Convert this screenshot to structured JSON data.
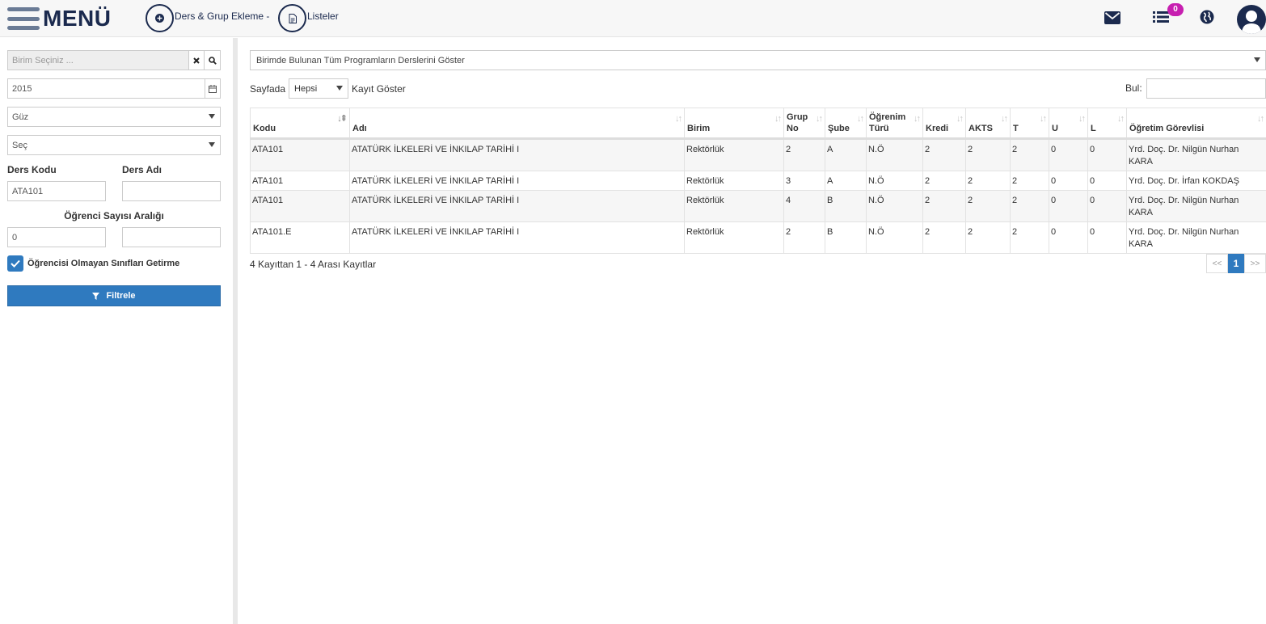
{
  "header": {
    "menu_label": "MENÜ",
    "nav": [
      {
        "label": "Ders & Grup Ekleme -",
        "icon": "plus-circle-icon"
      },
      {
        "label": "Listeler",
        "icon": "document-icon"
      }
    ],
    "notification_count": "0",
    "icons": [
      "envelope-icon",
      "list-icon",
      "globe-icon",
      "user-avatar-icon"
    ]
  },
  "sidebar": {
    "unit_placeholder": "Birim Seçiniz ...",
    "year": "2015",
    "term": "Güz",
    "select_default": "Seç",
    "course_code_label": "Ders Kodu",
    "course_name_label": "Ders Adı",
    "course_code_value": "ATA101",
    "course_name_value": "",
    "student_range_label": "Öğrenci Sayısı Aralığı",
    "student_min": "0",
    "student_max": "",
    "exclude_empty_label": "Öğrencisi Olmayan Sınıfları Getirme",
    "exclude_empty_checked": true,
    "filter_label": "Filtrele"
  },
  "main": {
    "program_select": "Birimde Bulunan Tüm Programların Derslerini Göster",
    "length_prefix": "Sayfada",
    "length_value": "Hepsi",
    "length_suffix": "Kayıt Göster",
    "search_label": "Bul:",
    "search_value": "",
    "columns": {
      "kodu": "Kodu",
      "adi": "Adı",
      "birim": "Birim",
      "grup_no": [
        "Grup",
        "No"
      ],
      "sube": "Şube",
      "ogrenim_turu": [
        "Öğrenim",
        "Türü"
      ],
      "kredi": "Kredi",
      "akts": "AKTS",
      "t": "T",
      "u": "U",
      "l": "L",
      "ogretim_gorevlisi": "Öğretim Görevlisi"
    },
    "rows": [
      {
        "kodu": "ATA101",
        "adi": "ATATÜRK İLKELERİ VE İNKILAP TARİHİ I",
        "birim": "Rektörlük",
        "grup_no": "2",
        "sube": "A",
        "ogrenim_turu": "N.Ö",
        "kredi": "2",
        "akts": "2",
        "t": "2",
        "u": "0",
        "l": "0",
        "ogretim_gorevlisi": "Yrd. Doç. Dr. Nilgün Nurhan KARA"
      },
      {
        "kodu": "ATA101",
        "adi": "ATATÜRK İLKELERİ VE İNKILAP TARİHİ I",
        "birim": "Rektörlük",
        "grup_no": "3",
        "sube": "A",
        "ogrenim_turu": "N.Ö",
        "kredi": "2",
        "akts": "2",
        "t": "2",
        "u": "0",
        "l": "0",
        "ogretim_gorevlisi": "Yrd. Doç. Dr. İrfan KOKDAŞ"
      },
      {
        "kodu": "ATA101",
        "adi": "ATATÜRK İLKELERİ VE İNKILAP TARİHİ I",
        "birim": "Rektörlük",
        "grup_no": "4",
        "sube": "B",
        "ogrenim_turu": "N.Ö",
        "kredi": "2",
        "akts": "2",
        "t": "2",
        "u": "0",
        "l": "0",
        "ogretim_gorevlisi": "Yrd. Doç. Dr. Nilgün Nurhan KARA"
      },
      {
        "kodu": "ATA101.E",
        "adi": "ATATÜRK İLKELERİ VE İNKILAP TARİHİ I",
        "birim": "Rektörlük",
        "grup_no": "2",
        "sube": "B",
        "ogrenim_turu": "N.Ö",
        "kredi": "2",
        "akts": "2",
        "t": "2",
        "u": "0",
        "l": "0",
        "ogretim_gorevlisi": "Yrd. Doç. Dr. Nilgün Nurhan KARA"
      }
    ],
    "info": "4 Kayıttan 1 - 4 Arası Kayıtlar",
    "pager": {
      "prev": "<<",
      "current": "1",
      "next": ">>"
    }
  },
  "colors": {
    "accent": "#2f7abf",
    "navy": "#1b2a4e",
    "badge": "#c71fb0"
  }
}
